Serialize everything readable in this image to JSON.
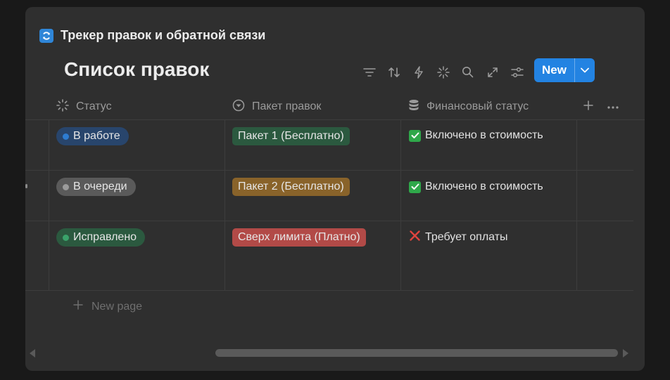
{
  "database": {
    "title": "Трекер правок и обратной связи",
    "icon": "sync-icon",
    "view_title": "Список правок"
  },
  "toolbar": {
    "icons": [
      "filter-icon",
      "sort-icon",
      "automation-icon",
      "ai-sparkle-icon",
      "search-icon",
      "expand-icon",
      "settings-sliders-icon"
    ],
    "new_label": "New"
  },
  "columns": [
    {
      "label": "Статус",
      "icon": "status-spinner-icon"
    },
    {
      "label": "Пакет правок",
      "icon": "select-circle-icon"
    },
    {
      "label": "Финансовый статус",
      "icon": "database-icon"
    }
  ],
  "rows": [
    {
      "status": {
        "label": "В работе",
        "bg": "#28456c",
        "dot": "#2e7cd1"
      },
      "package": {
        "label": "Пакет 1 (Бесплатно)",
        "bg": "#2b593f"
      },
      "finance": {
        "label": "Включено в стоимость",
        "icon": "check-mark-icon"
      }
    },
    {
      "status": {
        "label": "В очереди",
        "bg": "#5a5a5a",
        "dot": "#9b9b9b"
      },
      "package": {
        "label": "Пакет 2 (Бесплатно)",
        "bg": "#89632a"
      },
      "finance": {
        "label": "Включено в стоимость",
        "icon": "check-mark-icon"
      }
    },
    {
      "status": {
        "label": "Исправлено",
        "bg": "#2b593f",
        "dot": "#3aa26a"
      },
      "package": {
        "label": "Сверх лимита (Платно)",
        "bg": "#b24a47"
      },
      "finance": {
        "label": "Требует оплаты",
        "icon": "cross-mark-icon"
      }
    }
  ],
  "new_page_label": "New page",
  "colors": {
    "background": "#191919",
    "panel": "#2f2f2f",
    "accent": "#2383e2",
    "check_green": "#2fa84a",
    "cross_red": "#e0443e"
  }
}
